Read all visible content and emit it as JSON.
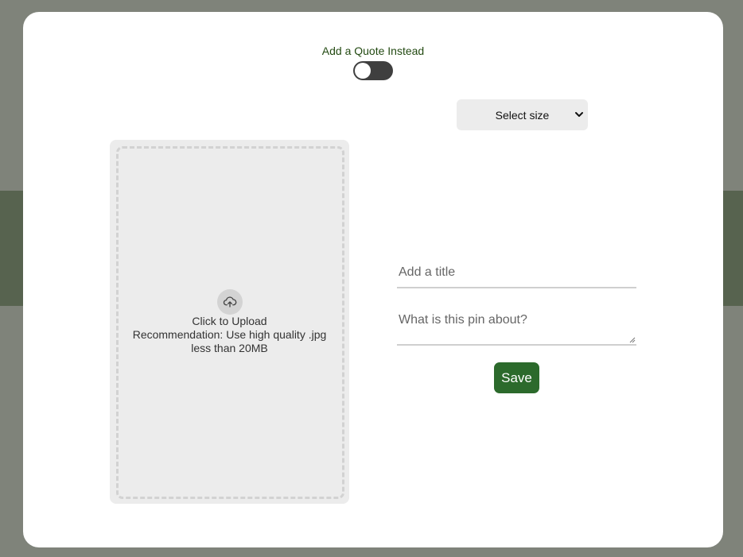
{
  "quote_toggle": {
    "label": "Add a Quote Instead",
    "state": "off"
  },
  "size_select": {
    "selected": "Select size"
  },
  "upload": {
    "line1": "Click to Upload",
    "line2": "Recommendation: Use high quality .jpg",
    "line3": "less than 20MB",
    "icon": "cloud-upload-icon"
  },
  "form": {
    "title_placeholder": "Add a title",
    "about_placeholder": "What is this pin about?",
    "save_label": "Save"
  },
  "colors": {
    "accent": "#2c6a2c",
    "label_green": "#234a12",
    "backdrop": "#7f837a",
    "backdrop_band": "#57634f"
  }
}
